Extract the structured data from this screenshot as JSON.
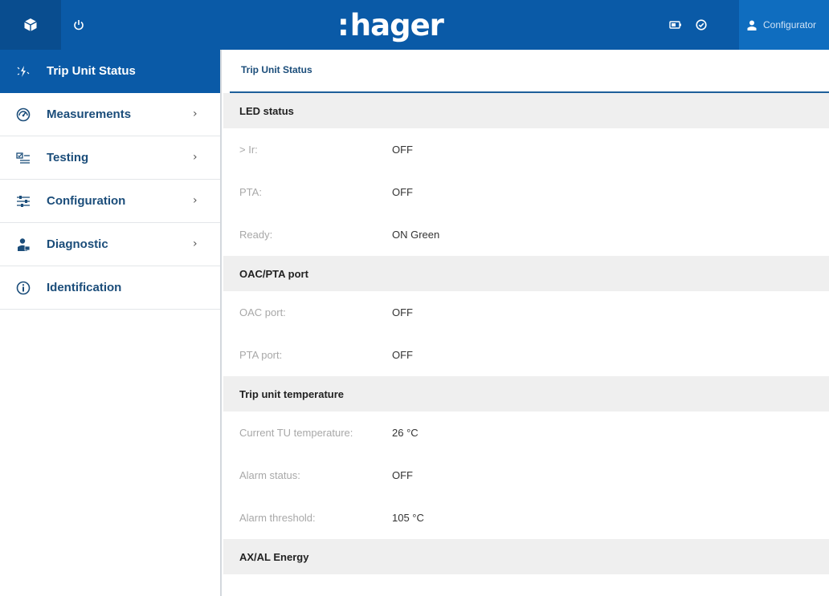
{
  "header": {
    "logo_colon": ":",
    "logo_text": "hager",
    "user_label": "Configurator"
  },
  "icons": {
    "home": "box-icon",
    "power": "power-icon",
    "battery": "battery-icon",
    "check": "check-circle-icon",
    "user": "user-icon"
  },
  "colors": {
    "brand_blue": "#0a5aa7",
    "dark_blue": "#094d8f",
    "label_blue": "#1b4d7a",
    "section_bg": "#efefef"
  },
  "sidebar": {
    "items": [
      {
        "label": "Trip Unit Status",
        "icon": "lightning-sparkle-icon",
        "active": true,
        "has_chevron": false
      },
      {
        "label": "Measurements",
        "icon": "gauge-icon",
        "has_chevron": true
      },
      {
        "label": "Testing",
        "icon": "checklist-icon",
        "has_chevron": true
      },
      {
        "label": "Configuration",
        "icon": "sliders-icon",
        "has_chevron": true
      },
      {
        "label": "Diagnostic",
        "icon": "technician-icon",
        "has_chevron": true
      },
      {
        "label": "Identification",
        "icon": "info-icon",
        "has_chevron": false
      }
    ],
    "chevron": "›"
  },
  "main": {
    "tab": "Trip Unit Status",
    "sections": [
      {
        "title": "LED status",
        "rows": [
          {
            "label": "> Ir:",
            "value": "OFF"
          },
          {
            "label": "PTA:",
            "value": "OFF"
          },
          {
            "label": "Ready:",
            "value": "ON Green"
          }
        ]
      },
      {
        "title": "OAC/PTA port",
        "rows": [
          {
            "label": "OAC port:",
            "value": "OFF"
          },
          {
            "label": "PTA port:",
            "value": "OFF"
          }
        ]
      },
      {
        "title": "Trip unit temperature",
        "rows": [
          {
            "label": "Current TU temperature:",
            "value": "26 °C"
          },
          {
            "label": "Alarm status:",
            "value": "OFF"
          },
          {
            "label": "Alarm threshold:",
            "value": "105 °C"
          }
        ]
      },
      {
        "title": "AX/AL Energy",
        "rows": []
      }
    ]
  }
}
